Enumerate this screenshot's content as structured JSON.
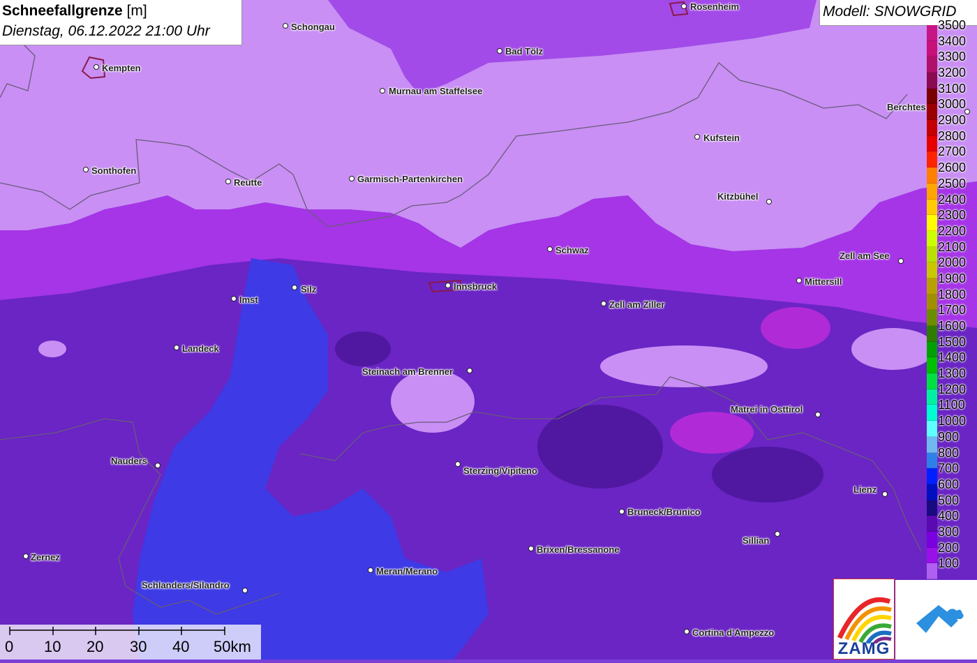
{
  "title": {
    "bold": "Schneefallgrenze",
    "unit": " [m]",
    "datetime": "Dienstag, 06.12.2022 21:00 Uhr"
  },
  "model": "Modell: SNOWGRID",
  "legend": [
    {
      "value": "3500",
      "color": "#c71585"
    },
    {
      "value": "3400",
      "color": "#c7107a"
    },
    {
      "value": "3300",
      "color": "#b0106a"
    },
    {
      "value": "3200",
      "color": "#8b0a50"
    },
    {
      "value": "3100",
      "color": "#7a0000"
    },
    {
      "value": "3000",
      "color": "#9b0000"
    },
    {
      "value": "2900",
      "color": "#c40000"
    },
    {
      "value": "2800",
      "color": "#e60000"
    },
    {
      "value": "2700",
      "color": "#ff2400"
    },
    {
      "value": "2600",
      "color": "#ff7f00"
    },
    {
      "value": "2500",
      "color": "#ffa500"
    },
    {
      "value": "2400",
      "color": "#ffcc00"
    },
    {
      "value": "2300",
      "color": "#ffff00"
    },
    {
      "value": "2200",
      "color": "#ccff00"
    },
    {
      "value": "2100",
      "color": "#b8e000"
    },
    {
      "value": "2000",
      "color": "#c8c800"
    },
    {
      "value": "1900",
      "color": "#b8a000"
    },
    {
      "value": "1800",
      "color": "#a09000"
    },
    {
      "value": "1700",
      "color": "#6b8e00"
    },
    {
      "value": "1600",
      "color": "#2e7d00"
    },
    {
      "value": "1500",
      "color": "#00a000"
    },
    {
      "value": "1400",
      "color": "#00c000"
    },
    {
      "value": "1300",
      "color": "#00e040"
    },
    {
      "value": "1200",
      "color": "#00f0a0"
    },
    {
      "value": "1100",
      "color": "#00ffd0"
    },
    {
      "value": "1000",
      "color": "#60ffff"
    },
    {
      "value": "900",
      "color": "#70b8f0"
    },
    {
      "value": "800",
      "color": "#2f7fe8"
    },
    {
      "value": "700",
      "color": "#0020ff"
    },
    {
      "value": "600",
      "color": "#0010c0"
    },
    {
      "value": "500",
      "color": "#1a0a80"
    },
    {
      "value": "400",
      "color": "#5a0ab0"
    },
    {
      "value": "300",
      "color": "#7a00e0"
    },
    {
      "value": "200",
      "color": "#9a10e8"
    },
    {
      "value": "100",
      "color": "#b060f0"
    }
  ],
  "cities": [
    {
      "name": "Schongau"
    },
    {
      "name": "Rosenheim"
    },
    {
      "name": "Kempten"
    },
    {
      "name": "Bad Tölz"
    },
    {
      "name": "Murnau am Staffelsee"
    },
    {
      "name": "Berchtes"
    },
    {
      "name": "Kufstein"
    },
    {
      "name": "Sonthofen"
    },
    {
      "name": "Reutte"
    },
    {
      "name": "Garmisch-Partenkirchen"
    },
    {
      "name": "Kitzbühel"
    },
    {
      "name": "Schwaz"
    },
    {
      "name": "Zell am See"
    },
    {
      "name": "Imst"
    },
    {
      "name": "Silz"
    },
    {
      "name": "Innsbruck"
    },
    {
      "name": "Mittersill"
    },
    {
      "name": "Zell am Ziller"
    },
    {
      "name": "Landeck"
    },
    {
      "name": "Steinach am Brenner"
    },
    {
      "name": "Matrei in Osttirol"
    },
    {
      "name": "Nauders"
    },
    {
      "name": "Sterzing/Vipiteno"
    },
    {
      "name": "Lienz"
    },
    {
      "name": "Bruneck/Brunico"
    },
    {
      "name": "Sillian"
    },
    {
      "name": "Brixen/Bressanone"
    },
    {
      "name": "Zernez"
    },
    {
      "name": "Meran/Merano"
    },
    {
      "name": "Schlanders/Silandro"
    },
    {
      "name": "Cortina d'Ampezzo"
    }
  ],
  "scale": {
    "labels": [
      "0",
      "10",
      "20",
      "30",
      "40",
      "50km"
    ]
  },
  "logo": {
    "zamg_text": "ZAMG"
  },
  "colors": {
    "map_light": "#c88df2",
    "map_mid": "#9b3fe8",
    "map_dark": "#5a1fb0",
    "map_blue": "#3d3ae6",
    "map_magenta": "#b02ad8"
  }
}
